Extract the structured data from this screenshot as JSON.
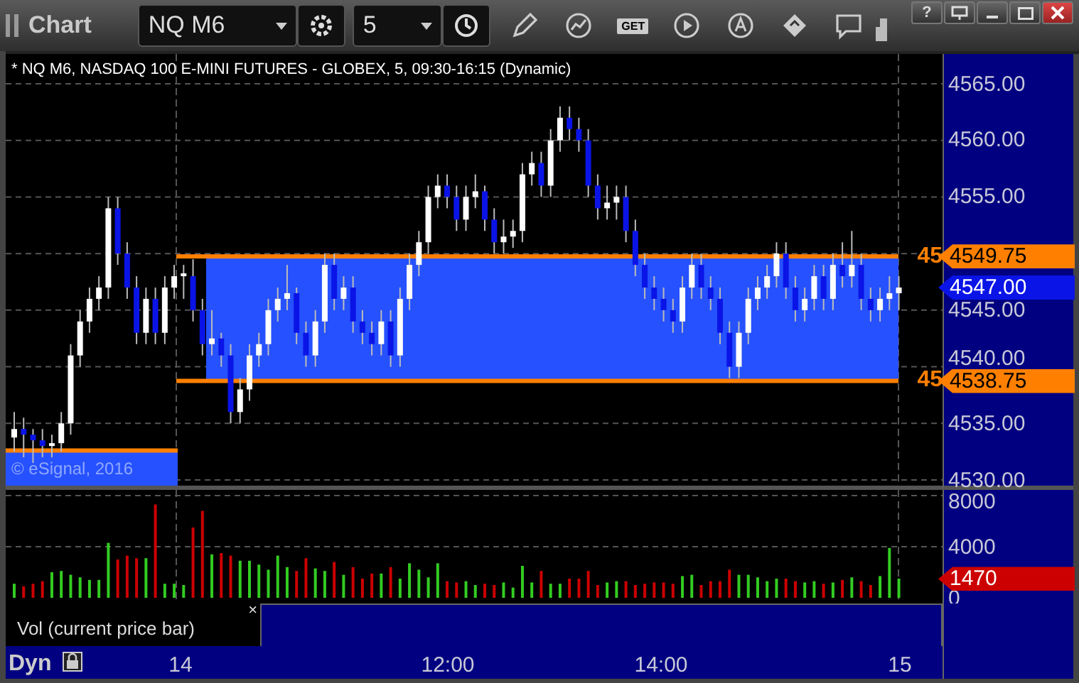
{
  "window": {
    "title": "Chart",
    "help": "?"
  },
  "toolbar": {
    "symbol": "NQ M6",
    "interval": "5",
    "get_label": "GET"
  },
  "price_pane": {
    "title": "* NQ M6, NASDAQ 100 E-MINI FUTURES - GLOBEX, 5, 09:30-16:15 (Dynamic)",
    "copyright": "© eSignal, 2016",
    "markers": [
      {
        "tag": "45",
        "value": "4549.75",
        "color": "#ff8000"
      },
      {
        "value": "4547.00",
        "color": "#0a14e6"
      },
      {
        "tag": "45",
        "value": "4538.75",
        "color": "#ff8000"
      }
    ],
    "chart_data": {
      "type": "candlestick",
      "ylim": [
        4530,
        4565
      ],
      "grid": true,
      "yticks": [
        {
          "value": 4565,
          "label": "4565.00"
        },
        {
          "value": 4560,
          "label": "4560.00"
        },
        {
          "value": 4555,
          "label": "4555.00"
        },
        {
          "value": 4545,
          "label": "4545.00"
        },
        {
          "value": 4540,
          "label": "4540.00"
        },
        {
          "value": 4535,
          "label": "4535.00"
        },
        {
          "value": 4530,
          "label": "4530.00"
        }
      ],
      "ohlc": [
        [
          4533.75,
          4536,
          4532.5,
          4534.5
        ],
        [
          4534.5,
          4535.5,
          4532,
          4534
        ],
        [
          4534,
          4534.5,
          4531.5,
          4533.5
        ],
        [
          4533.5,
          4534.5,
          4532,
          4533
        ],
        [
          4533,
          4534,
          4532,
          4533.25
        ],
        [
          4533.25,
          4536,
          4532.5,
          4535
        ],
        [
          4535,
          4542,
          4534,
          4541
        ],
        [
          4541,
          4545,
          4540,
          4544
        ],
        [
          4544,
          4547,
          4543,
          4546
        ],
        [
          4546,
          4548,
          4545,
          4547
        ],
        [
          4547,
          4555,
          4546,
          4554
        ],
        [
          4554,
          4555,
          4549,
          4550
        ],
        [
          4550,
          4551,
          4546,
          4547
        ],
        [
          4547,
          4548,
          4542,
          4543
        ],
        [
          4543,
          4547,
          4542,
          4546
        ],
        [
          4546,
          4547,
          4542,
          4543
        ],
        [
          4543,
          4548,
          4542,
          4547
        ],
        [
          4547,
          4549,
          4546,
          4548
        ],
        [
          4548,
          4549,
          4546,
          4548.25
        ],
        [
          4548,
          4549.5,
          4544,
          4545
        ],
        [
          4545,
          4546,
          4541,
          4542
        ],
        [
          4542,
          4545,
          4541,
          4542.5
        ],
        [
          4542.5,
          4543,
          4540,
          4541
        ],
        [
          4541,
          4542,
          4535,
          4536
        ],
        [
          4536,
          4539,
          4535,
          4538
        ],
        [
          4538,
          4542,
          4537,
          4541
        ],
        [
          4541,
          4543,
          4540,
          4542
        ],
        [
          4542,
          4546,
          4541,
          4545
        ],
        [
          4545,
          4547,
          4544,
          4546
        ],
        [
          4546,
          4549,
          4545,
          4546.5
        ],
        [
          4546.5,
          4547,
          4542,
          4543
        ],
        [
          4543,
          4544,
          4540,
          4541
        ],
        [
          4541,
          4545,
          4540,
          4544
        ],
        [
          4544,
          4550,
          4543,
          4549
        ],
        [
          4549,
          4550,
          4545,
          4546
        ],
        [
          4546,
          4548,
          4545,
          4547
        ],
        [
          4547,
          4548,
          4543,
          4544
        ],
        [
          4544,
          4545,
          4542,
          4543
        ],
        [
          4543,
          4544,
          4541,
          4542
        ],
        [
          4542,
          4545,
          4541,
          4544
        ],
        [
          4544,
          4545,
          4540,
          4541
        ],
        [
          4541,
          4547,
          4540,
          4546
        ],
        [
          4546,
          4550,
          4545,
          4549
        ],
        [
          4549,
          4552,
          4548,
          4551
        ],
        [
          4551,
          4556,
          4550,
          4555
        ],
        [
          4555,
          4557,
          4554,
          4556
        ],
        [
          4556,
          4557,
          4554,
          4555
        ],
        [
          4555,
          4556,
          4552,
          4553
        ],
        [
          4553,
          4556,
          4552,
          4555
        ],
        [
          4555,
          4557,
          4554,
          4555.5
        ],
        [
          4555.5,
          4556,
          4552,
          4553
        ],
        [
          4553,
          4554,
          4550,
          4551
        ],
        [
          4551,
          4553,
          4550,
          4551.5
        ],
        [
          4551.5,
          4553,
          4550.5,
          4552
        ],
        [
          4552,
          4558,
          4551,
          4557
        ],
        [
          4557,
          4559,
          4556,
          4558
        ],
        [
          4558,
          4559,
          4555,
          4556
        ],
        [
          4556,
          4561,
          4555,
          4560
        ],
        [
          4560,
          4563,
          4559,
          4562
        ],
        [
          4562,
          4563,
          4560,
          4561
        ],
        [
          4561,
          4562,
          4559,
          4560
        ],
        [
          4560,
          4561,
          4555,
          4556
        ],
        [
          4556,
          4557,
          4553,
          4554
        ],
        [
          4554,
          4556,
          4553,
          4554.5
        ],
        [
          4554.5,
          4556,
          4553,
          4555
        ],
        [
          4555,
          4556,
          4551,
          4552
        ],
        [
          4552,
          4553,
          4548,
          4549
        ],
        [
          4549,
          4550,
          4546,
          4547
        ],
        [
          4547,
          4548,
          4545,
          4546
        ],
        [
          4546,
          4547,
          4544,
          4545
        ],
        [
          4545,
          4546,
          4543,
          4544
        ],
        [
          4544,
          4548,
          4543,
          4547
        ],
        [
          4547,
          4550,
          4546,
          4549
        ],
        [
          4549,
          4550,
          4546,
          4547
        ],
        [
          4547,
          4548,
          4545,
          4546
        ],
        [
          4546,
          4547,
          4542,
          4543
        ],
        [
          4543,
          4544,
          4539,
          4540
        ],
        [
          4540,
          4544,
          4539,
          4543
        ],
        [
          4543,
          4547,
          4542,
          4546
        ],
        [
          4546,
          4548,
          4545,
          4547
        ],
        [
          4547,
          4549,
          4546,
          4548
        ],
        [
          4548,
          4551,
          4547,
          4550
        ],
        [
          4550,
          4551,
          4546,
          4547
        ],
        [
          4547,
          4548,
          4544,
          4545
        ],
        [
          4545,
          4547,
          4544,
          4546
        ],
        [
          4546,
          4549,
          4545,
          4548
        ],
        [
          4548,
          4549,
          4545,
          4546
        ],
        [
          4546,
          4550,
          4545,
          4549
        ],
        [
          4549,
          4551,
          4547,
          4548
        ],
        [
          4548,
          4552,
          4547,
          4549
        ],
        [
          4549,
          4550,
          4545,
          4546
        ],
        [
          4546,
          4547,
          4544,
          4545
        ],
        [
          4545,
          4547,
          4544,
          4546
        ],
        [
          4546,
          4548,
          4545,
          4546.5
        ],
        [
          4546.5,
          4548,
          4545,
          4547
        ]
      ]
    }
  },
  "volume_pane": {
    "current": {
      "value": "1470",
      "color": "#cc0000"
    },
    "legend": "Vol (current price bar)",
    "close": "×",
    "chart_data": {
      "type": "bar",
      "ylim": [
        0,
        8000
      ],
      "grid": true,
      "yticks": [
        {
          "value": 8000,
          "label": "8000"
        },
        {
          "value": 4000,
          "label": "4000"
        },
        {
          "value": 0,
          "label": "0"
        }
      ],
      "series": [
        {
          "values": [
            1100,
            900,
            1100,
            1300,
            2000,
            2100,
            1800,
            1600,
            1400,
            1400,
            4300,
            3000,
            3300,
            3100,
            3100,
            7300,
            1100,
            1100,
            1000,
            5500,
            6800,
            3400,
            3500,
            3300,
            2900,
            2900,
            2600,
            2200,
            3300,
            2400,
            2100,
            3100,
            2300,
            2100,
            2800,
            1800,
            2400,
            1500,
            1900,
            1900,
            2400,
            1500,
            2700,
            2200,
            1600,
            2700,
            1300,
            1200,
            1300,
            1000,
            1100,
            1000,
            1200,
            800,
            2500,
            1200,
            2100,
            1100,
            1100,
            1500,
            1500,
            2100,
            1000,
            1200,
            1300,
            1300,
            1000,
            1100,
            1200,
            1200,
            1100,
            1700,
            1800,
            1000,
            1300,
            1300,
            2200,
            1800,
            1800,
            1600,
            1300,
            1500,
            1500,
            1300,
            1200,
            1300,
            1100,
            1200,
            1400,
            1600,
            1300,
            1000,
            1700,
            3900,
            1500
          ]
        }
      ]
    }
  },
  "time_axis": {
    "mode": "Dyn",
    "labels": [
      "14",
      "12:00",
      "14:00",
      "15"
    ]
  }
}
